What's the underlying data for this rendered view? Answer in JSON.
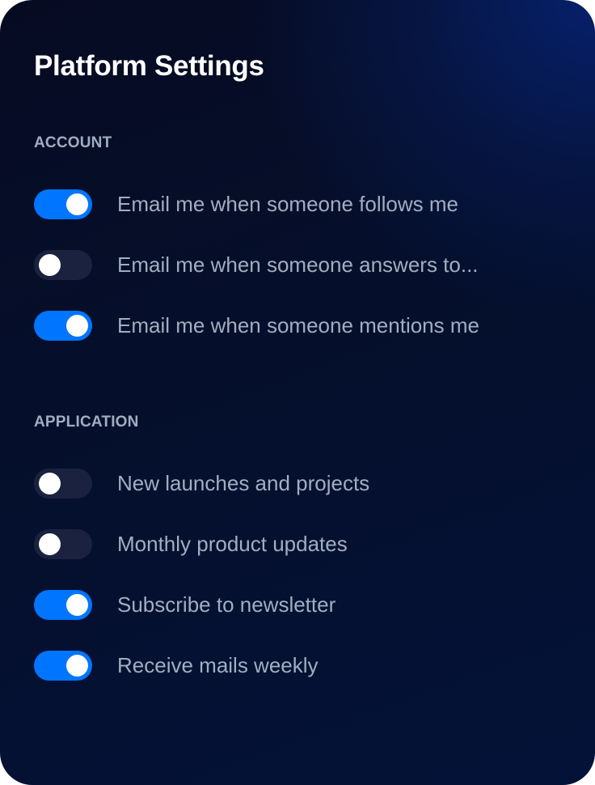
{
  "card": {
    "title": "Platform Settings"
  },
  "sections": {
    "account": {
      "heading": "ACCOUNT",
      "items": [
        {
          "label": "Email me when someone follows me",
          "enabled": true
        },
        {
          "label": "Email me when someone answers to...",
          "enabled": false
        },
        {
          "label": "Email me when someone mentions me",
          "enabled": true
        }
      ]
    },
    "application": {
      "heading": "APPLICATION",
      "items": [
        {
          "label": "New launches and projects",
          "enabled": false
        },
        {
          "label": "Monthly product updates",
          "enabled": false
        },
        {
          "label": "Subscribe to newsletter",
          "enabled": true
        },
        {
          "label": "Receive mails weekly",
          "enabled": true
        }
      ]
    }
  },
  "colors": {
    "toggle_on": "#0075ff",
    "toggle_off": "#1b2240",
    "label_text": "#a0aec0",
    "title_text": "#ffffff"
  }
}
